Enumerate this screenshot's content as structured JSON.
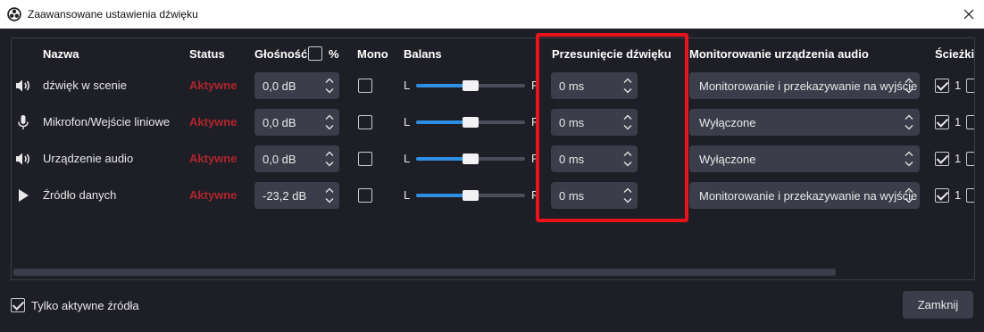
{
  "window": {
    "title": "Zaawansowane ustawienia dźwięku",
    "app_icon": "obs-logo-icon",
    "close_icon": "close-icon"
  },
  "headers": {
    "name": "Nazwa",
    "status": "Status",
    "volume": "Głośność",
    "volume_percent": "%",
    "mono": "Mono",
    "balance": "Balans",
    "sync_offset": "Przesunięcie dźwięku",
    "monitoring": "Monitorowanie urządzenia audio",
    "tracks": "Ścieżki"
  },
  "volume_percent_checked": false,
  "rows": [
    {
      "icon": "speaker-icon",
      "name": "dźwięk w scenie",
      "status": "Aktywne",
      "volume": "0,0 dB",
      "mono": false,
      "balance_left": "L",
      "balance_right": "R",
      "balance": 0.5,
      "offset": "0 ms",
      "monitoring": "Monitorowanie i przekazywanie na wyjście",
      "track1_checked": true,
      "track1_label": "1"
    },
    {
      "icon": "microphone-icon",
      "name": "Mikrofon/Wejście liniowe",
      "status": "Aktywne",
      "volume": "0,0 dB",
      "mono": false,
      "balance_left": "L",
      "balance_right": "R",
      "balance": 0.5,
      "offset": "0 ms",
      "monitoring": "Wyłączone",
      "track1_checked": true,
      "track1_label": "1"
    },
    {
      "icon": "speaker-icon",
      "name": "Urządzenie audio",
      "status": "Aktywne",
      "volume": "0,0 dB",
      "mono": false,
      "balance_left": "L",
      "balance_right": "R",
      "balance": 0.5,
      "offset": "0 ms",
      "monitoring": "Wyłączone",
      "track1_checked": true,
      "track1_label": "1"
    },
    {
      "icon": "play-icon",
      "name": "Źródło danych",
      "status": "Aktywne",
      "volume": "-23,2 dB",
      "mono": false,
      "balance_left": "L",
      "balance_right": "R",
      "balance": 0.5,
      "offset": "0 ms",
      "monitoring": "Monitorowanie i przekazywanie na wyjście",
      "track1_checked": true,
      "track1_label": "1"
    }
  ],
  "footer": {
    "only_active_label": "Tylko aktywne źródła",
    "only_active_checked": true,
    "close_button": "Zamknij"
  },
  "colors": {
    "background": "#1e1f26",
    "control": "#3b3e4a",
    "status_active": "#b0242c",
    "accent": "#2f8fe3",
    "highlight": "#e8121b"
  }
}
